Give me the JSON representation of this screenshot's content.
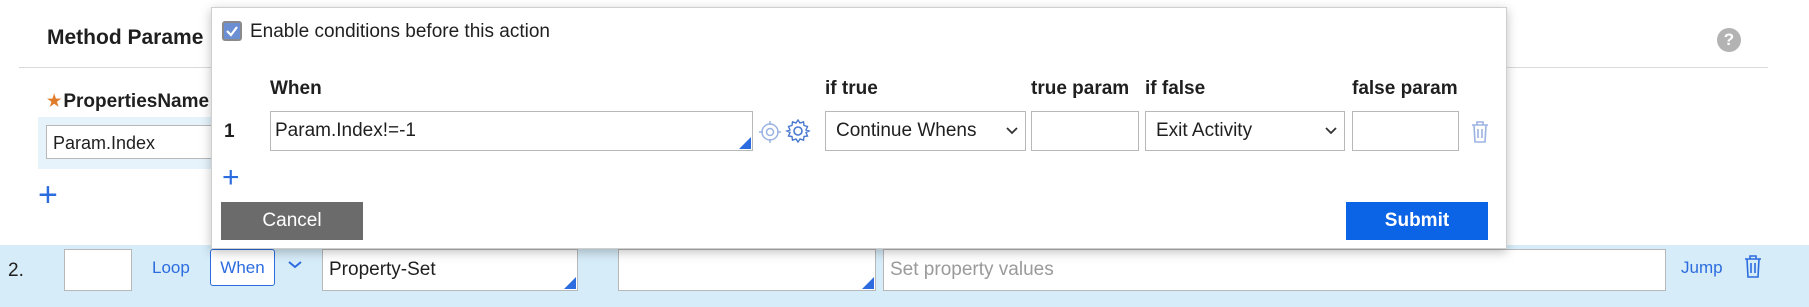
{
  "background": {
    "section_title": "Method Parame",
    "help_icon": "question-icon",
    "property_label": "PropertiesName",
    "property_value": "Param.Index",
    "add_icon": "plus-icon",
    "step": {
      "number": "2.",
      "loop_label": "Loop",
      "when_label": "When",
      "method_value": "Property-Set",
      "description_placeholder": "Set property values",
      "jump_label": "Jump"
    }
  },
  "modal": {
    "enable_label": "Enable conditions before this action",
    "enable_checked": true,
    "headers": {
      "when": "When",
      "if_true": "if true",
      "true_param": "true param",
      "if_false": "if false",
      "false_param": "false param"
    },
    "rows": [
      {
        "number": "1",
        "when_value": "Param.Index!=-1",
        "if_true_value": "Continue Whens",
        "true_param_value": "",
        "if_false_value": "Exit Activity",
        "false_param_value": ""
      }
    ],
    "cancel_label": "Cancel",
    "submit_label": "Submit"
  },
  "colors": {
    "accent": "#2d6cdf",
    "submit": "#0b63e5",
    "cancel": "#6b6b6b",
    "row_highlight": "#d6ecf8",
    "required": "#e07b2a"
  }
}
